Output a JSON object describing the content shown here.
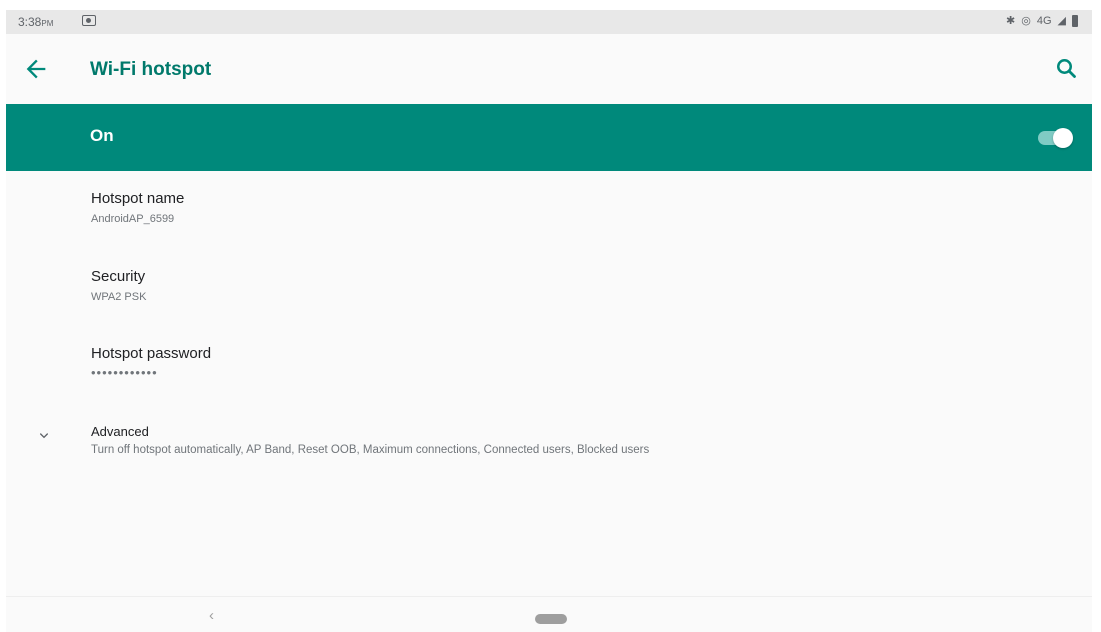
{
  "status_bar": {
    "time": "3:38",
    "ampm": "PM",
    "network": "4G"
  },
  "header": {
    "title": "Wi-Fi hotspot"
  },
  "master_switch": {
    "label": "On",
    "checked": true
  },
  "preferences": [
    {
      "title": "Hotspot name",
      "summary": "AndroidAP_6599"
    },
    {
      "title": "Security",
      "summary": "WPA2 PSK"
    },
    {
      "title": "Hotspot password",
      "summary": "••••••••••••"
    }
  ],
  "advanced": {
    "title": "Advanced",
    "summary": "Turn off hotspot automatically, AP Band, Reset OOB, Maximum connections, Connected users, Blocked users"
  },
  "colors": {
    "accent": "#00897b",
    "title": "#00796b",
    "background": "#fafafa"
  },
  "icons": {
    "back": "arrow-back-icon",
    "search": "search-icon",
    "advanced": "chevron-down-icon"
  }
}
